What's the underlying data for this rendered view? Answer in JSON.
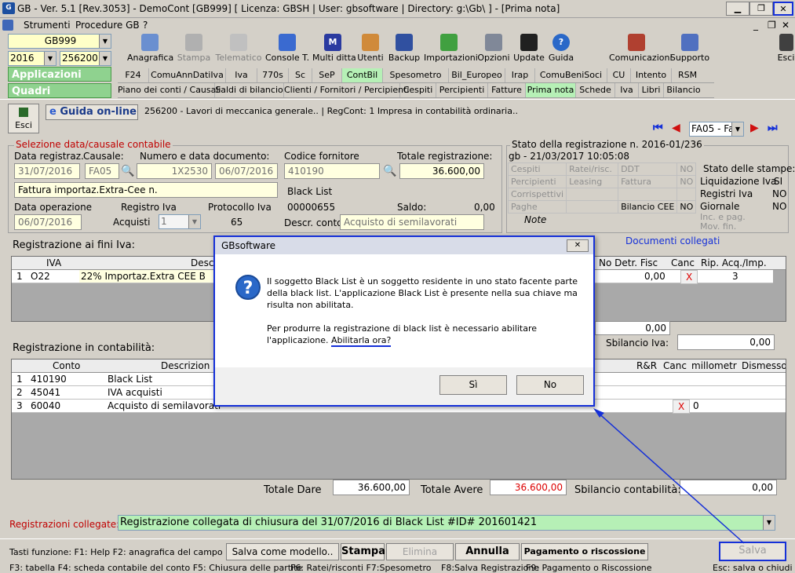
{
  "window": {
    "title": "GB - Ver. 5.1 [Rev.3053] - DemoCont [GB999]   [ Licenza: GBSH | User: gbsoftware | Directory: g:\\Gb\\ ] - [Prima nota]",
    "logo": "G",
    "minimize": "▁",
    "restore": "❐",
    "close": "✕"
  },
  "menu": {
    "items": [
      "Strumenti",
      "Procedure GB",
      "?"
    ],
    "doc_controls": [
      "_",
      "❐",
      "✕"
    ]
  },
  "selectors": {
    "company": "GB999",
    "year": "2016",
    "code": "256200 -"
  },
  "sidebar": {
    "applicazioni": "Applicazioni",
    "quadri": "Quadri"
  },
  "toolbar": {
    "items": [
      "Anagrafica",
      "Stampa",
      "Telematico",
      "Console T.",
      "Multi ditta",
      "Utenti",
      "Backup",
      "Importazioni",
      "Opzioni",
      "Update",
      "Guida",
      "Comunicazioni",
      "Supporto",
      "Esci"
    ]
  },
  "tabs1": [
    "F24",
    "ComuAnnDatiIva",
    "Iva",
    "770s",
    "Sc",
    "SeP",
    "ContBil",
    "Spesometro",
    "Bil_Europeo",
    "Irap",
    "ComuBeniSoci",
    "CU",
    "Intento",
    "RSM"
  ],
  "tabs2": [
    "Piano dei conti / Causali",
    "Saldi di bilancio",
    "Clienti / Fornitori / Percipienti",
    "Cespiti",
    "Percipienti",
    "Fatture",
    "Prima nota",
    "Schede",
    "Iva",
    "Libri",
    "Bilancio"
  ],
  "header": {
    "esci": "Esci",
    "guida": "Guida on-line",
    "info": "256200 - Lavori di meccanica generale.. | RegCont: 1 Impresa  in contabilità ordinaria..",
    "nav_value": "FA05 - Fa"
  },
  "selezione": {
    "legend": "Selezione data/causale contabile",
    "data_reg_label": "Data registraz.",
    "causale_label": "Causale:",
    "numero_label": "Numero e data documento:",
    "data_reg": "31/07/2016",
    "causale": "FA05",
    "numero": "1X2530",
    "data_doc": "06/07/2016",
    "descrizione": "Fattura importaz.Extra-Cee n.",
    "data_op_label": "Data operazione",
    "registro_label": "Registro Iva",
    "protocollo_label": "Protocollo Iva",
    "data_op": "06/07/2016",
    "registro": "Acquisti",
    "registro_num": "1",
    "protocollo": "65",
    "fornitore_label": "Codice fornitore",
    "totale_label": "Totale registrazione:",
    "fornitore": "410190",
    "totale": "36.600,00",
    "blacklist_label": "Black List",
    "blacklist_code": "00000655",
    "saldo_label": "Saldo:",
    "saldo": "0,00",
    "descr_conto_label": "Descr. conto",
    "descr_conto": "Acquisto di semilavorati"
  },
  "stato": {
    "legend": "Stato della registrazione n. 2016-01/236",
    "sub": "gb - 21/03/2017 10:05:08",
    "rows": [
      [
        "Cespiti",
        "Ratei/risc.",
        "DDT",
        "NO"
      ],
      [
        "Percipienti",
        "Leasing",
        "Fattura",
        "NO"
      ],
      [
        "Corrispettivi",
        "",
        "",
        ""
      ],
      [
        "Paghe",
        "",
        "Bilancio CEE",
        "NO"
      ]
    ],
    "note": "Note",
    "stampe_title": "Stato delle stampe:",
    "stampe": [
      [
        "Liquidazione Iva",
        "SI"
      ],
      [
        "Registri Iva",
        "NO"
      ],
      [
        "Giornale",
        "NO"
      ],
      [
        "Inc. e pag. Mov. fin.",
        ""
      ]
    ]
  },
  "iva": {
    "title": "Registrazione ai fini Iva:",
    "documenti": "Documenti collegati",
    "headers": [
      "IVA",
      "Desc",
      "No Detr. Fisc",
      "Canc",
      "Rip. Acq./Imp."
    ],
    "row": {
      "n": "1",
      "code": "O22",
      "desc": "22% Importaz.Extra CEE B",
      "nodetr": "0,00",
      "canc": "X",
      "rip": "3"
    },
    "total": "0,00",
    "sbilancio_label": "Sbilancio Iva:",
    "sbilancio": "0,00"
  },
  "contabilita": {
    "title": "Registrazione in contabilità:",
    "headers": [
      "Conto",
      "Descrizion",
      "R&R",
      "Canc",
      "millometr",
      "Dismesso"
    ],
    "rows": [
      {
        "n": "1",
        "conto": "410190",
        "desc": "Black List"
      },
      {
        "n": "2",
        "conto": "45041",
        "desc": "IVA acquisti"
      },
      {
        "n": "3",
        "conto": "60040",
        "desc": "Acquisto di semilavorati",
        "canc": "X",
        "millometr": "0"
      }
    ],
    "dare_label": "Totale Dare",
    "dare": "36.600,00",
    "avere_label": "Totale Avere",
    "avere": "36.600,00",
    "sbil_label": "Sbilancio contabilità:",
    "sbil": "0,00"
  },
  "collegate": {
    "label": "Registrazioni collegate:",
    "value": "Registrazione collegata di chiusura del 31/07/2016 di Black List  #ID# 201601421"
  },
  "bottom": {
    "keys1": "Tasti funzione: F1: Help  F2: anagrafica del campo",
    "salva_modello": "Salva come modello..",
    "stampa": "Stampa",
    "elimina": "Elimina",
    "annulla": "Annulla",
    "pagamento": "Pagamento o riscossione",
    "salva": "Salva",
    "keys2": "F3: tabella   F4: scheda contabile del conto   F5: Chiusura delle partite",
    "keys3": "F6: Ratei/risconti  F7:Spesometro",
    "keys4": "F8:Salva Registrazione",
    "keys5": "F9: Pagamento o Riscossione",
    "keys6": "Esc: salva o chiudi"
  },
  "dialog": {
    "title": "GBsoftware",
    "close": "✕",
    "icon": "?",
    "line1": "Il soggetto Black List  è un soggetto residente in uno stato facente parte",
    "line2": "della black list. L'applicazione Black List è presente nella sua chiave ma",
    "line3": "risulta non abilitata.",
    "line4": "Per produrre la registrazione di black list è necessario abilitare",
    "line5a": "l'applicazione. ",
    "line5b": "Abilitarla ora?",
    "yes": "Sì",
    "no": "No"
  }
}
